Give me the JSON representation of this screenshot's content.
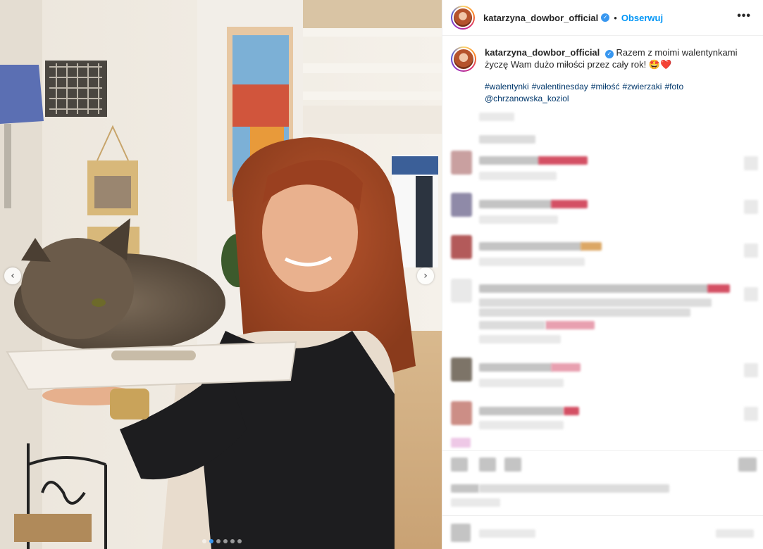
{
  "post": {
    "username": "katarzyna_dowbor_official",
    "follow_label": "Obserwuj",
    "separator": "•",
    "more_icon": "•••",
    "verified_icon": "✓",
    "caption": {
      "username": "katarzyna_dowbor_official",
      "text": "Razem z moimi walentynkami życzę Wam dużo miłości przez cały rok! 🤩❤️",
      "hashtags": [
        "#walentynki",
        "#valentinesday",
        "#miłość",
        "#zwierzaki",
        "#foto"
      ],
      "mention": "@chrzanowska_koziol"
    }
  },
  "carousel": {
    "prev_icon": "‹",
    "next_icon": "›",
    "dot_count": 6,
    "active_dot": 1
  },
  "colors": {
    "link": "#0095f6",
    "verified": "#3897f0",
    "hashtag": "#00376b"
  }
}
